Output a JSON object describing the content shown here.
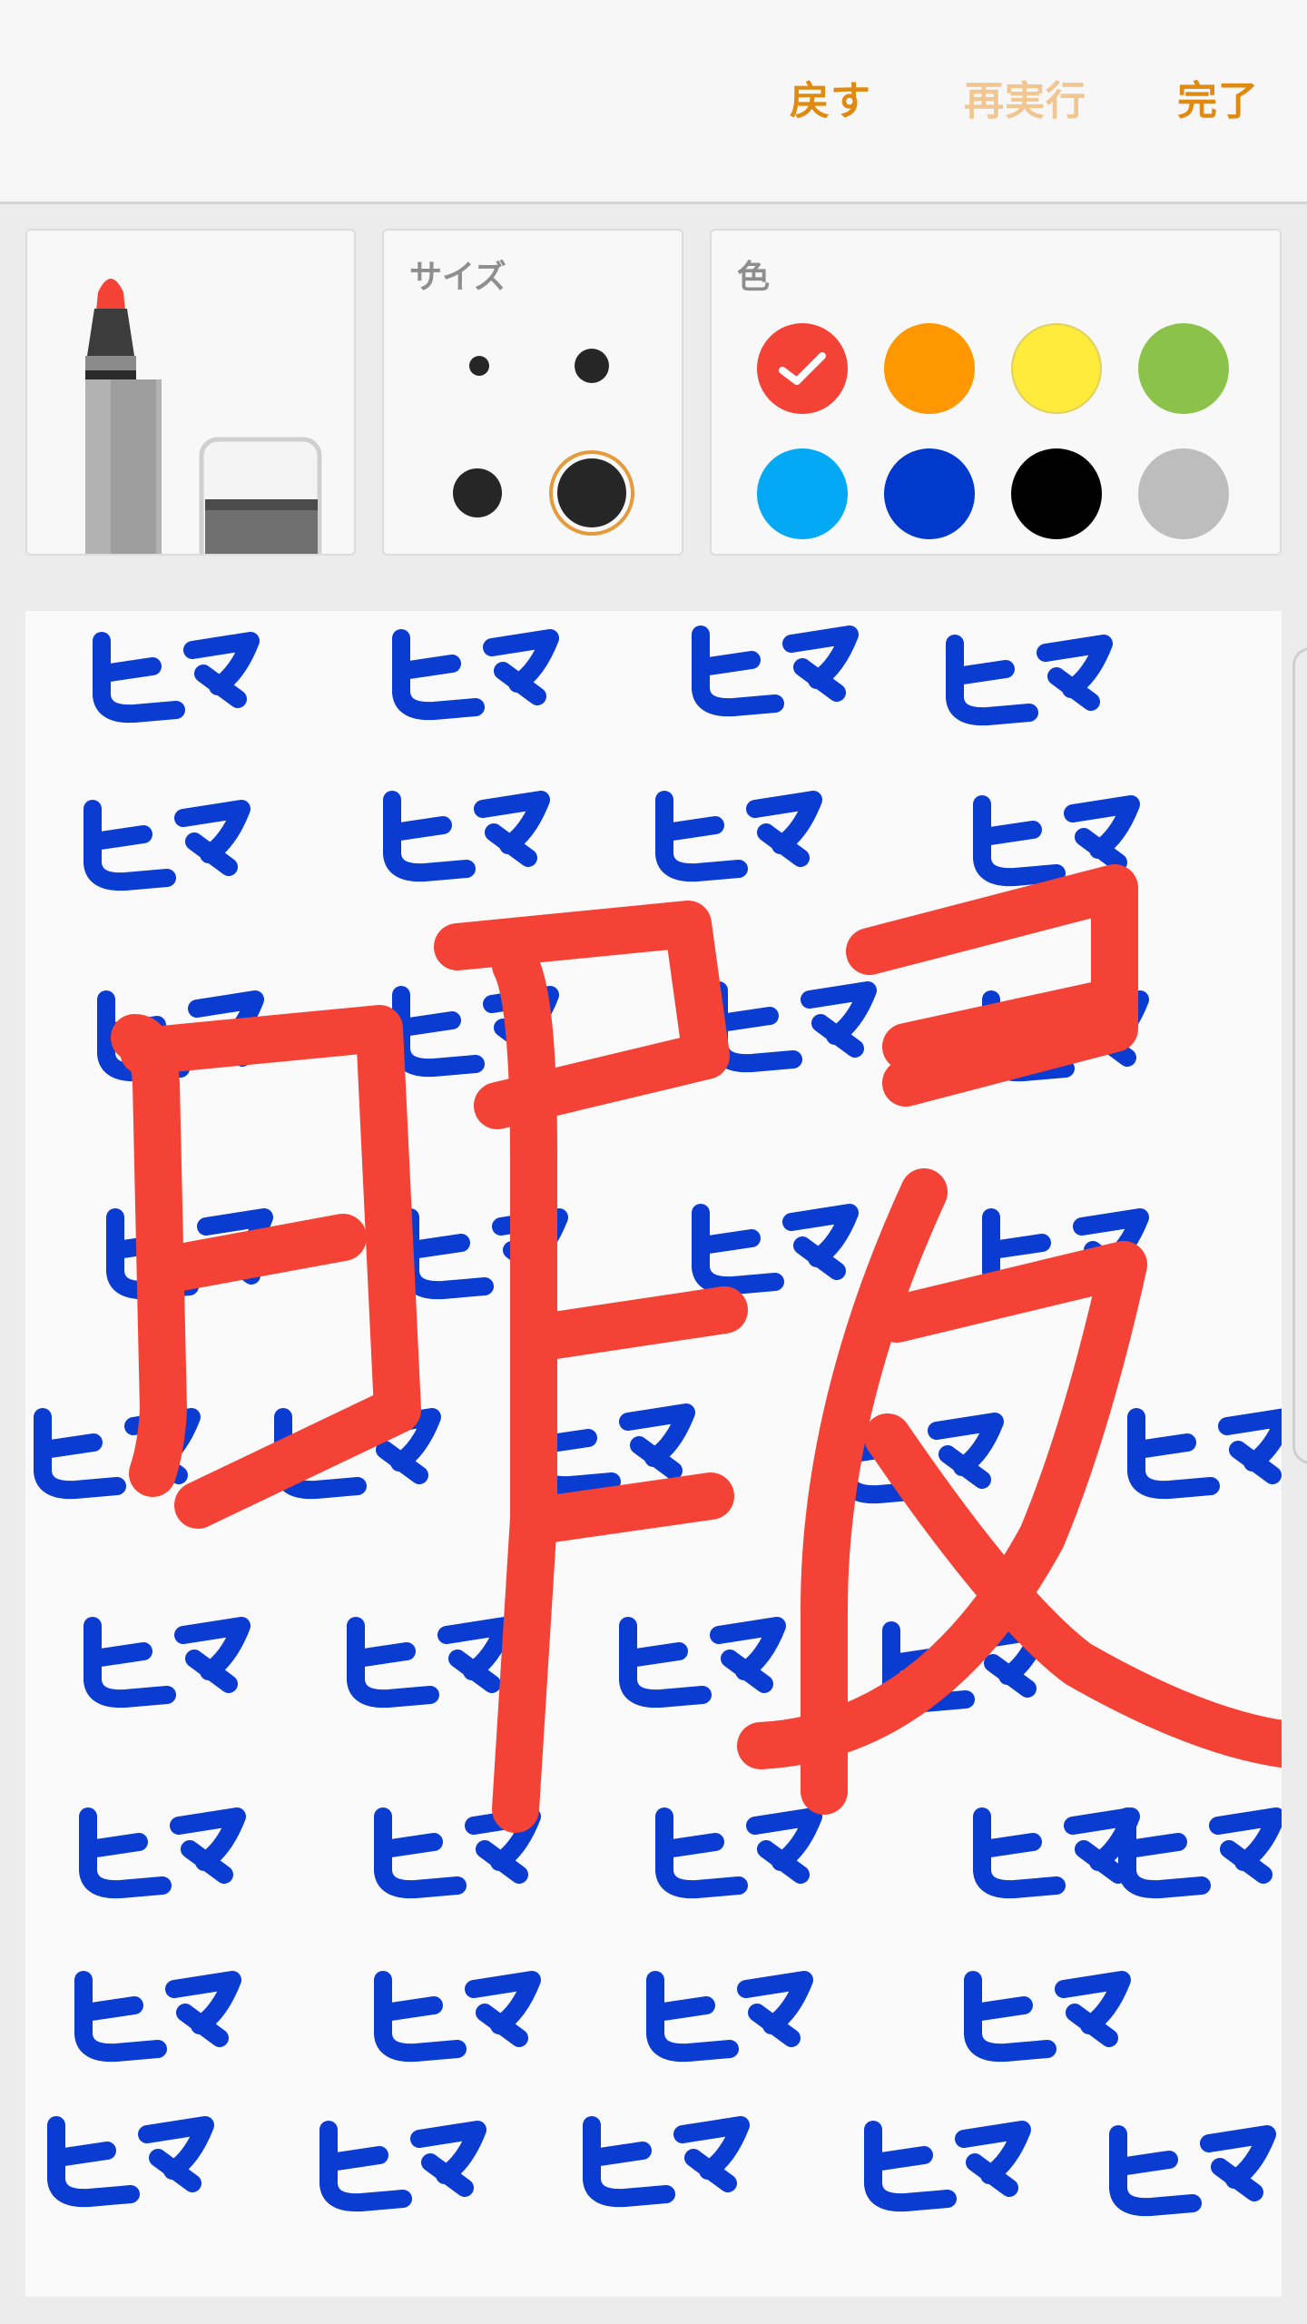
{
  "topbar": {
    "undo_label": "戻す",
    "redo_label": "再実行",
    "done_label": "完了"
  },
  "toolbar": {
    "tools": [
      {
        "name": "marker",
        "icon": "marker-pen-icon",
        "selected": true
      },
      {
        "name": "eraser",
        "icon": "eraser-icon",
        "selected": false
      }
    ],
    "size_panel": {
      "label": "サイズ",
      "sizes": [
        "extra-small",
        "small",
        "medium",
        "large"
      ],
      "selected": "large"
    },
    "color_panel": {
      "label": "色",
      "selected": "#f44336",
      "colors": [
        "#f44336",
        "#ff9800",
        "#ffeb3b",
        "#8bc34a",
        "#03a9f4",
        "#0039cc",
        "#000000",
        "#bdbdbd"
      ]
    }
  },
  "canvas": {
    "stroke_colors": {
      "blue": "#0a3cd2",
      "red": "#f44336"
    },
    "handwritten_text": [
      "ヒマ",
      "暇"
    ]
  }
}
